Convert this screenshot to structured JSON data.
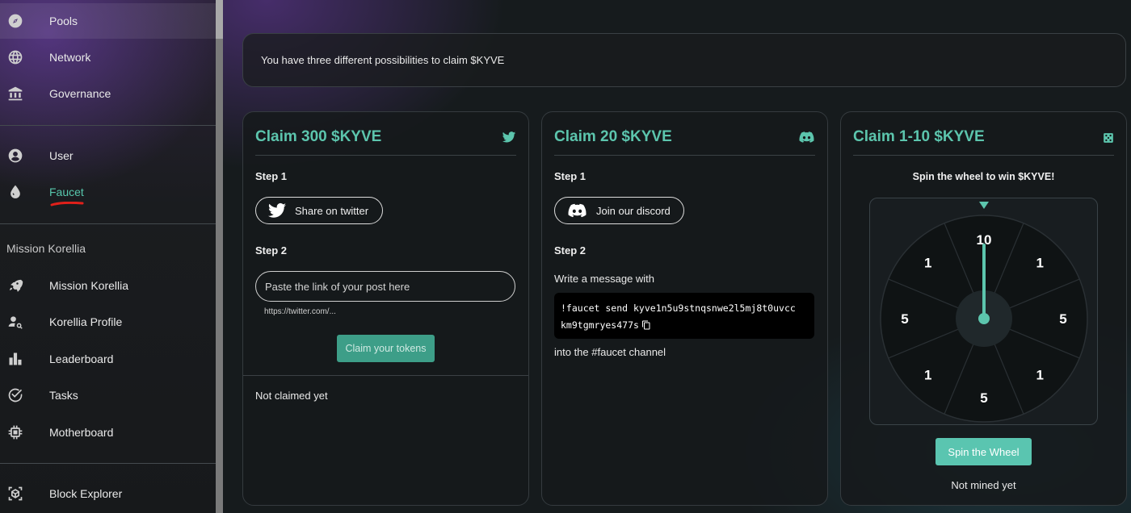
{
  "sidebar": {
    "items_top": [
      {
        "label": "Pools",
        "icon": "compass-icon"
      },
      {
        "label": "Network",
        "icon": "globe-icon"
      },
      {
        "label": "Governance",
        "icon": "bank-icon"
      }
    ],
    "items_user": [
      {
        "label": "User",
        "icon": "user-icon"
      },
      {
        "label": "Faucet",
        "icon": "drop-icon"
      }
    ],
    "section_title": "Mission Korellia",
    "items_mission": [
      {
        "label": "Mission Korellia",
        "icon": "rocket-icon"
      },
      {
        "label": "Korellia Profile",
        "icon": "profile-search-icon"
      },
      {
        "label": "Leaderboard",
        "icon": "bar-chart-icon"
      },
      {
        "label": "Tasks",
        "icon": "check-circle-icon"
      },
      {
        "label": "Motherboard",
        "icon": "chip-icon"
      }
    ],
    "items_bottom": [
      {
        "label": "Block Explorer",
        "icon": "cube-icon"
      }
    ],
    "active_color": "#57c7ad"
  },
  "banner": {
    "text": "You have three different possibilities to claim $KYVE"
  },
  "cards": {
    "twitter": {
      "title": "Claim 300 $KYVE",
      "icon": "twitter-icon",
      "step1": "Step 1",
      "button": "Share on twitter",
      "step2": "Step 2",
      "input_placeholder": "Paste the link of your post here",
      "input_value": "",
      "hint": "https://twitter.com/...",
      "claim_button": "Claim your tokens",
      "status": "Not claimed yet"
    },
    "discord": {
      "title": "Claim 20 $KYVE",
      "icon": "discord-icon",
      "step1": "Step 1",
      "button": "Join our discord",
      "step2": "Step 2",
      "instruction": "Write a message with",
      "command_line1": "!faucet send kyve1n5u9stnqsnwe2l5mj8t0uvcc",
      "command_line2": "km9tgmryes477s",
      "channel_text": "into the #faucet channel"
    },
    "wheel": {
      "title": "Claim 1-10 $KYVE",
      "icon": "dice-icon",
      "heading": "Spin the wheel to win $KYVE!",
      "segments": [
        "10",
        "1",
        "5",
        "1",
        "5",
        "1",
        "5",
        "1"
      ],
      "spin_button": "Spin the Wheel",
      "status": "Not mined yet"
    }
  },
  "colors": {
    "accent": "#5cc5ad",
    "claim_button": "#3d9e88",
    "spin_button": "#5ac5b0"
  }
}
